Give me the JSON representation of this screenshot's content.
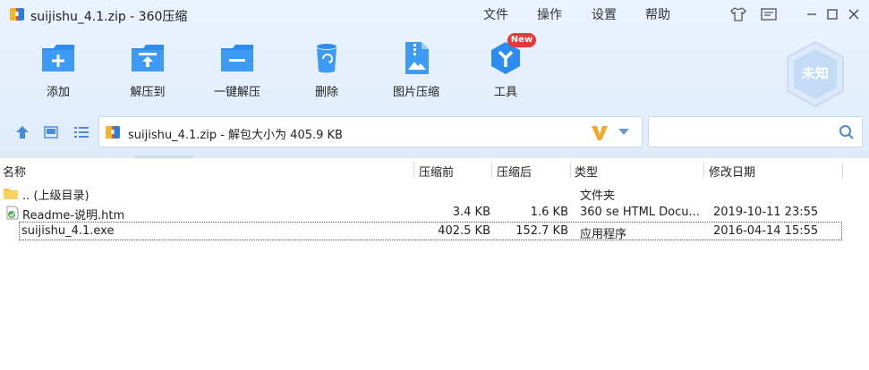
{
  "window": {
    "title": "suijishu_4.1.zip - 360压缩",
    "menu": [
      "文件",
      "操作",
      "设置",
      "帮助"
    ]
  },
  "toolbar": {
    "items": [
      {
        "label": "添加",
        "icon": "add-file-icon"
      },
      {
        "label": "解压到",
        "icon": "extract-to-icon"
      },
      {
        "label": "一键解压",
        "icon": "one-click-extract-icon"
      },
      {
        "label": "删除",
        "icon": "delete-icon"
      },
      {
        "label": "图片压缩",
        "icon": "image-compress-icon"
      },
      {
        "label": "工具",
        "icon": "tools-icon"
      }
    ],
    "new_badge": "New",
    "status_badge": "未知"
  },
  "address": {
    "path": "suijishu_4.1.zip - 解包大小为 405.9 KB"
  },
  "search": {
    "placeholder": ""
  },
  "table": {
    "columns": [
      "名称",
      "压缩前",
      "压缩后",
      "类型",
      "修改日期"
    ],
    "rows": [
      {
        "name": ".. (上级目录)",
        "before": "",
        "after": "",
        "type": "文件夹",
        "date": "",
        "icon": "folder-icon"
      },
      {
        "name": "Readme-说明.htm",
        "before": "3.4 KB",
        "after": "1.6 KB",
        "type": "360 se HTML Docu...",
        "date": "2019-10-11 23:55",
        "icon": "html-file-icon"
      },
      {
        "name": "suijishu_4.1.exe",
        "before": "402.5 KB",
        "after": "152.7 KB",
        "type": "应用程序",
        "date": "2016-04-14 15:55",
        "icon": "exe-file-icon"
      }
    ]
  },
  "colors": {
    "accent": "#2d8cf0",
    "toolbar_bg": "#e4effc",
    "badge_red": "#e8393a"
  }
}
